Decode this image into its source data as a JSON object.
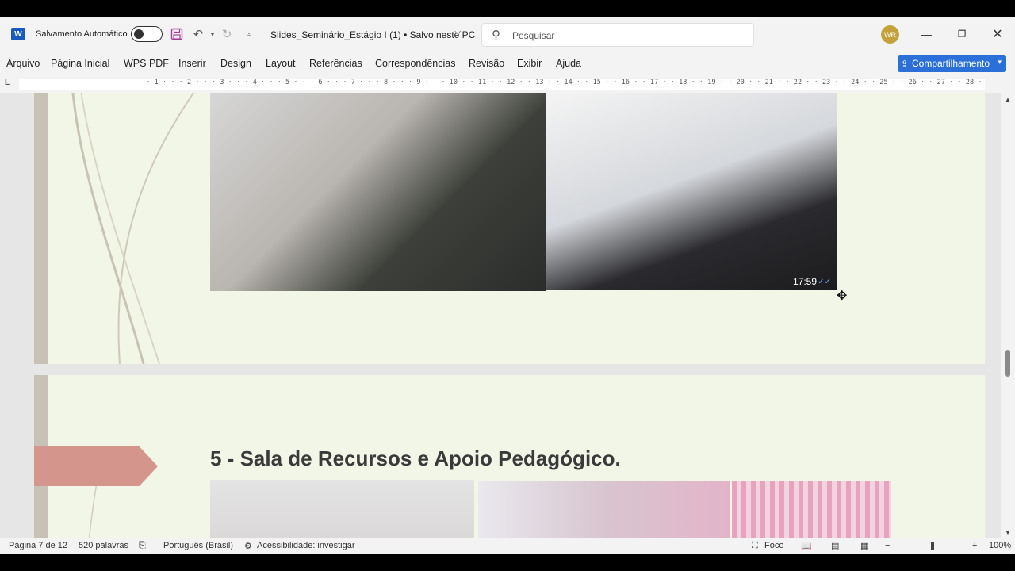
{
  "titlebar": {
    "autosave_label": "Salvamento Automático",
    "doc_title": "Slides_Seminário_Estágio I (1)  •  Salvo neste PC",
    "search_placeholder": "Pesquisar",
    "avatar_initials": "WR"
  },
  "menu": {
    "items": [
      "Arquivo",
      "Página Inicial",
      "WPS PDF",
      "Inserir",
      "Design",
      "Layout",
      "Referências",
      "Correspondências",
      "Revisão",
      "Exibir",
      "Ajuda"
    ],
    "share_label": "Compartilhamento"
  },
  "ruler": {
    "labels": "· · 1 · · · 2 · · · 3 · · · 4 · · · 5 · · · 6 · · · 7 · · · 8 · · · 9 · · · 10 · · 11 · · 12 · · 13 · · 14 · · 15 · · 16 · · 17 · · 18 · · 19 · · 20 · · 21 · · 22 · · 23 · · 24 · · 25 · · 26 · · 27 · · 28 · ·"
  },
  "document": {
    "photo_timestamp": "17:59",
    "heading": "5 - Sala de Recursos e Apoio Pedagógico."
  },
  "status": {
    "page": "Página 7 de 12",
    "words": "520 palavras",
    "language": "Português (Brasil)",
    "accessibility": "Acessibilidade: investigar",
    "focus": "Foco",
    "zoom": "100%"
  },
  "colors": {
    "accent": "#2b6fd8",
    "page_background": "#f2f6e6",
    "arrow": "#d4968c"
  }
}
